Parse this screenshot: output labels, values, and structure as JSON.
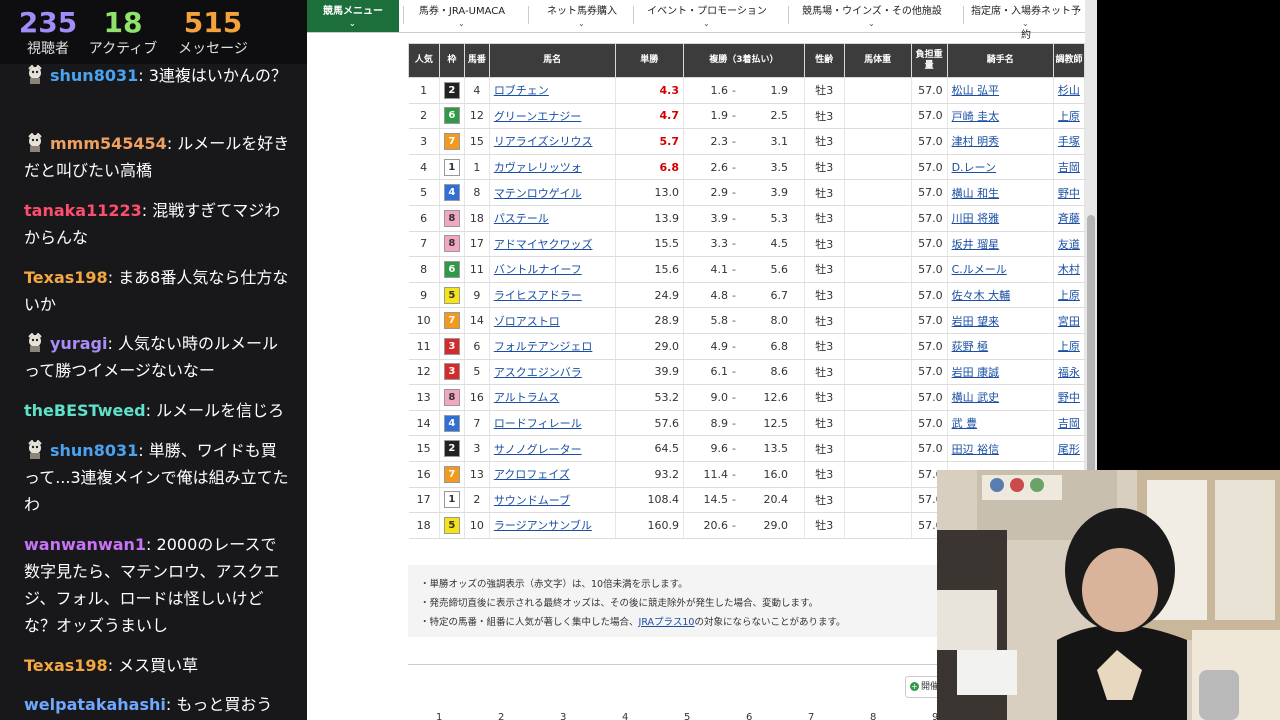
{
  "stats": [
    {
      "value": "235",
      "label": "視聴者",
      "color": "#a28cf7"
    },
    {
      "value": "18",
      "label": "アクティブ",
      "color": "#8fe36b"
    },
    {
      "value": "515",
      "label": "メッセージ",
      "color": "#f3a23c"
    }
  ],
  "chat": [
    {
      "user": "shun8031",
      "color": "#4aa3f0",
      "badge": true,
      "text": "3連複はいかんの？"
    },
    {
      "user": "mmm545454",
      "color": "#f0a060",
      "badge": true,
      "text": "ルメールを好きだと叫びたい高橋"
    },
    {
      "user": "tanaka11223",
      "color": "#ff4d6d",
      "badge": false,
      "text": "混戦すぎてマジわからんな"
    },
    {
      "user": "Texas198",
      "color": "#f5a742",
      "badge": false,
      "text": "まあ8番人気なら仕方ないか"
    },
    {
      "user": "yuragi",
      "color": "#a88df5",
      "badge": true,
      "text": "人気ない時のルメールって勝つイメージないなー"
    },
    {
      "user": "theBESTweed",
      "color": "#5fe0c8",
      "badge": false,
      "text": "ルメールを信じろ"
    },
    {
      "user": "shun8031",
      "color": "#4aa3f0",
      "badge": true,
      "text": "単勝、ワイドも買って...3連複メインで俺は組み立てたわ"
    },
    {
      "user": "wanwanwan1",
      "color": "#c874f5",
      "badge": false,
      "text": "2000のレースで数字見たら、マテンロウ、アスクエジ、フォル、ロードは怪しいけどな？オッズうまいし"
    },
    {
      "user": "Texas198",
      "color": "#f5a742",
      "badge": false,
      "text": "メス買い草"
    },
    {
      "user": "welpatakahashi",
      "color": "#6fa8ff",
      "badge": false,
      "text": "もっと買おう"
    }
  ],
  "nav": [
    {
      "label": "競馬メニュー",
      "active": true
    },
    {
      "label": "馬券・JRA-UMACA",
      "active": false
    },
    {
      "label": "ネット馬券購入",
      "active": false
    },
    {
      "label": "イベント・プロモーション",
      "active": false
    },
    {
      "label": "競馬場・ウインズ・その他施設",
      "active": false
    },
    {
      "label": "指定席・入場券ネット予約",
      "active": false
    }
  ],
  "table": {
    "headers": [
      "人気",
      "枠",
      "馬番",
      "馬名",
      "単勝",
      "複勝（3着払い）",
      "性齢",
      "馬体重",
      "負担重量",
      "騎手名",
      "調教師"
    ],
    "rows": [
      {
        "pop": "1",
        "waku": "2",
        "num": "4",
        "name": "ロブチェン",
        "win": "4.3",
        "red": true,
        "p1": "1.6",
        "p2": "1.9",
        "sex": "牡3",
        "weight": "",
        "burden": "57.0",
        "jockey": "松山 弘平",
        "trainer": "杉山"
      },
      {
        "pop": "2",
        "waku": "6",
        "num": "12",
        "name": "グリーンエナジー",
        "win": "4.7",
        "red": true,
        "p1": "1.9",
        "p2": "2.5",
        "sex": "牡3",
        "weight": "",
        "burden": "57.0",
        "jockey": "戸崎 圭太",
        "trainer": "上原"
      },
      {
        "pop": "3",
        "waku": "7",
        "num": "15",
        "name": "リアライズシリウス",
        "win": "5.7",
        "red": true,
        "p1": "2.3",
        "p2": "3.1",
        "sex": "牡3",
        "weight": "",
        "burden": "57.0",
        "jockey": "津村 明秀",
        "trainer": "手塚"
      },
      {
        "pop": "4",
        "waku": "1",
        "num": "1",
        "name": "カヴァレリッツォ",
        "win": "6.8",
        "red": true,
        "p1": "2.6",
        "p2": "3.5",
        "sex": "牡3",
        "weight": "",
        "burden": "57.0",
        "jockey": "D.レーン",
        "trainer": "吉岡"
      },
      {
        "pop": "5",
        "waku": "4",
        "num": "8",
        "name": "マテンロウゲイル",
        "win": "13.0",
        "red": false,
        "p1": "2.9",
        "p2": "3.9",
        "sex": "牡3",
        "weight": "",
        "burden": "57.0",
        "jockey": "横山 和生",
        "trainer": "野中"
      },
      {
        "pop": "6",
        "waku": "8",
        "num": "18",
        "name": "パステール",
        "win": "13.9",
        "red": false,
        "p1": "3.9",
        "p2": "5.3",
        "sex": "牡3",
        "weight": "",
        "burden": "57.0",
        "jockey": "川田 将雅",
        "trainer": "斉藤"
      },
      {
        "pop": "7",
        "waku": "8",
        "num": "17",
        "name": "アドマイヤクワッズ",
        "win": "15.5",
        "red": false,
        "p1": "3.3",
        "p2": "4.5",
        "sex": "牡3",
        "weight": "",
        "burden": "57.0",
        "jockey": "坂井 瑠星",
        "trainer": "友道"
      },
      {
        "pop": "8",
        "waku": "6",
        "num": "11",
        "name": "バントルナイーフ",
        "win": "15.6",
        "red": false,
        "p1": "4.1",
        "p2": "5.6",
        "sex": "牡3",
        "weight": "",
        "burden": "57.0",
        "jockey": "C.ルメール",
        "trainer": "木村"
      },
      {
        "pop": "9",
        "waku": "5",
        "num": "9",
        "name": "ライヒスアドラー",
        "win": "24.9",
        "red": false,
        "p1": "4.8",
        "p2": "6.7",
        "sex": "牡3",
        "weight": "",
        "burden": "57.0",
        "jockey": "佐々木 大輔",
        "trainer": "上原"
      },
      {
        "pop": "10",
        "waku": "7",
        "num": "14",
        "name": "ゾロアストロ",
        "win": "28.9",
        "red": false,
        "p1": "5.8",
        "p2": "8.0",
        "sex": "牡3",
        "weight": "",
        "burden": "57.0",
        "jockey": "岩田 望来",
        "trainer": "宮田"
      },
      {
        "pop": "11",
        "waku": "3",
        "num": "6",
        "name": "フォルテアンジェロ",
        "win": "29.0",
        "red": false,
        "p1": "4.9",
        "p2": "6.8",
        "sex": "牡3",
        "weight": "",
        "burden": "57.0",
        "jockey": "荻野 極",
        "trainer": "上原"
      },
      {
        "pop": "12",
        "waku": "3",
        "num": "5",
        "name": "アスクエジンバラ",
        "win": "39.9",
        "red": false,
        "p1": "6.1",
        "p2": "8.6",
        "sex": "牡3",
        "weight": "",
        "burden": "57.0",
        "jockey": "岩田 康誠",
        "trainer": "福永"
      },
      {
        "pop": "13",
        "waku": "8",
        "num": "16",
        "name": "アルトラムス",
        "win": "53.2",
        "red": false,
        "p1": "9.0",
        "p2": "12.6",
        "sex": "牡3",
        "weight": "",
        "burden": "57.0",
        "jockey": "横山 武史",
        "trainer": "野中"
      },
      {
        "pop": "14",
        "waku": "4",
        "num": "7",
        "name": "ロードフィレール",
        "win": "57.6",
        "red": false,
        "p1": "8.9",
        "p2": "12.5",
        "sex": "牡3",
        "weight": "",
        "burden": "57.0",
        "jockey": "武 豊",
        "trainer": "吉岡"
      },
      {
        "pop": "15",
        "waku": "2",
        "num": "3",
        "name": "サノノグレーター",
        "win": "64.5",
        "red": false,
        "p1": "9.6",
        "p2": "13.5",
        "sex": "牡3",
        "weight": "",
        "burden": "57.0",
        "jockey": "田辺 裕信",
        "trainer": "尾形"
      },
      {
        "pop": "16",
        "waku": "7",
        "num": "13",
        "name": "アクロフェイズ",
        "win": "93.2",
        "red": false,
        "p1": "11.4",
        "p2": "16.0",
        "sex": "牡3",
        "weight": "",
        "burden": "57.0",
        "jockey": "",
        "trainer": ""
      },
      {
        "pop": "17",
        "waku": "1",
        "num": "2",
        "name": "サウンドムーブ",
        "win": "108.4",
        "red": false,
        "p1": "14.5",
        "p2": "20.4",
        "sex": "牡3",
        "weight": "",
        "burden": "57.0",
        "jockey": "",
        "trainer": ""
      },
      {
        "pop": "18",
        "waku": "5",
        "num": "10",
        "name": "ラージアンサンブル",
        "win": "160.9",
        "red": false,
        "p1": "20.6",
        "p2": "29.0",
        "sex": "牡3",
        "weight": "",
        "burden": "57.0",
        "jockey": "",
        "trainer": ""
      }
    ]
  },
  "waku_colors": {
    "1": {
      "bg": "#ffffff",
      "fg": "#333333"
    },
    "2": {
      "bg": "#222222",
      "fg": "#ffffff"
    },
    "3": {
      "bg": "#d32b2b",
      "fg": "#ffffff"
    },
    "4": {
      "bg": "#2f6fd6",
      "fg": "#ffffff"
    },
    "5": {
      "bg": "#f5e31a",
      "fg": "#333333"
    },
    "6": {
      "bg": "#2f9a45",
      "fg": "#ffffff"
    },
    "7": {
      "bg": "#f39a1e",
      "fg": "#ffffff"
    },
    "8": {
      "bg": "#f3a6c3",
      "fg": "#333333"
    }
  },
  "notes": {
    "line1": "単勝オッズの強調表示（赤文字）は、10倍未満を示します。",
    "line2": "発売締切直後に表示される最終オッズは、その後に競走除外が発生した場合、変動します。",
    "line3_pre": "特定の馬番・組番に人気が著しく集中した場合、",
    "line3_link": "JRAプラス10",
    "line3_post": "の対象にならないことがあります。"
  },
  "open_button": "開催",
  "pager": [
    "1",
    "2",
    "3",
    "4",
    "5",
    "6",
    "7",
    "8",
    "9"
  ]
}
